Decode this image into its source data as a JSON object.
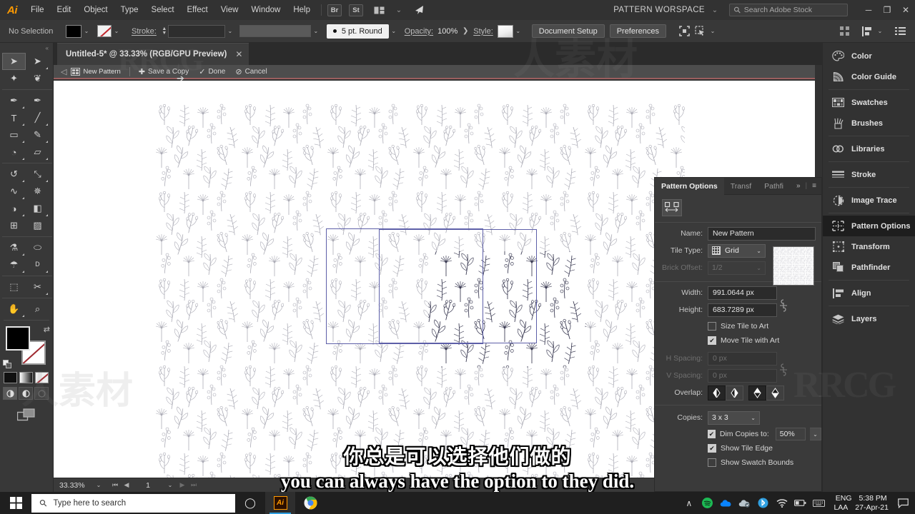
{
  "app": {
    "name": "Adobe Illustrator",
    "logo_text": "Ai",
    "accent_color": "#ff9a00"
  },
  "menubar": {
    "items": [
      "File",
      "Edit",
      "Object",
      "Type",
      "Select",
      "Effect",
      "View",
      "Window",
      "Help"
    ],
    "quick_icons": [
      {
        "name": "bridge-icon",
        "label": "Br"
      },
      {
        "name": "stock-icon",
        "label": "St"
      },
      {
        "name": "arrange-documents-icon",
        "label": "▤"
      },
      {
        "name": "chevron-down-icon",
        "label": "⌄"
      },
      {
        "name": "home-icon",
        "label": "➤"
      }
    ],
    "workspace": "PATTERN WORSPACE",
    "workspace_caret": "⌄",
    "search_placeholder": "Search Adobe Stock",
    "search_icon": "⌕",
    "window_controls": {
      "minimize": "─",
      "maximize": "❐",
      "close": "✕"
    }
  },
  "controlbar": {
    "selection_state": "No Selection",
    "fill_color": "#000000",
    "stroke_label": "Stroke:",
    "stroke_weight": "",
    "stroke_profile": "",
    "brush_label": "5 pt. Round",
    "opacity_label": "Opacity:",
    "opacity_value": "100%",
    "opacity_arrow": "❯",
    "style_label": "Style:",
    "buttons": [
      "Document Setup",
      "Preferences"
    ],
    "right_icons": [
      {
        "name": "transform-each-icon",
        "glyph": "⛶"
      },
      {
        "name": "select-similar-icon",
        "glyph": "⬚"
      },
      {
        "name": "arrange-grid-icon",
        "glyph": "∷"
      },
      {
        "name": "align-icon",
        "glyph": "⫶"
      },
      {
        "name": "properties-list-icon",
        "glyph": "☰"
      }
    ],
    "caret": "⌄"
  },
  "document_tab": {
    "title": "Untitled-5* @ 33.33% (RGB/GPU Preview)",
    "close": "✕"
  },
  "pattern_edit_bar": {
    "back_arrow": "◁",
    "swatch_name": "New Pattern",
    "actions": [
      {
        "name": "save-a-copy",
        "glyph": "✚",
        "label": "Save a Copy"
      },
      {
        "name": "done",
        "glyph": "✓",
        "label": "Done"
      },
      {
        "name": "cancel",
        "glyph": "⊘",
        "label": "Cancel"
      }
    ]
  },
  "pattern_options": {
    "tabs": [
      {
        "label": "Pattern Options",
        "active": true
      },
      {
        "label": "Transf",
        "active": false
      },
      {
        "label": "Pathfi",
        "active": false
      }
    ],
    "more_glyph": "»",
    "menu_glyph": "≡",
    "tile_tool_glyph": "⇔",
    "name_label": "Name:",
    "name_value": "New Pattern",
    "tile_type_label": "Tile Type:",
    "tile_type_value": "Grid",
    "brick_offset_label": "Brick Offset:",
    "brick_offset_value": "1/2",
    "width_label": "Width:",
    "width_value": "991.0644 px",
    "height_label": "Height:",
    "height_value": "683.7289 px",
    "link_glyph": "⚯",
    "size_tile_to_art": {
      "label": "Size Tile to Art",
      "checked": false
    },
    "move_tile_with_art": {
      "label": "Move Tile with Art",
      "checked": true
    },
    "h_spacing_label": "H Spacing:",
    "h_spacing_value": "0 px",
    "v_spacing_label": "V Spacing:",
    "v_spacing_value": "0 px",
    "overlap_label": "Overlap:",
    "overlap_options": [
      {
        "name": "overlap-left-in-front",
        "selected": true
      },
      {
        "name": "overlap-right-in-front",
        "selected": false
      },
      {
        "name": "overlap-bottom-in-front",
        "selected": true
      },
      {
        "name": "overlap-top-in-front",
        "selected": false
      }
    ],
    "copies_label": "Copies:",
    "copies_value": "3 x 3",
    "dim_copies": {
      "label": "Dim Copies to:",
      "checked": true,
      "value": "50%"
    },
    "show_tile_edge": {
      "label": "Show Tile Edge",
      "checked": true
    },
    "show_swatch_bounds": {
      "label": "Show Swatch Bounds",
      "checked": false
    },
    "caret": "⌄",
    "check_glyph": "✔"
  },
  "dock": {
    "groups": [
      [
        {
          "label": "Color",
          "icon": "color-palette-icon",
          "active": false
        },
        {
          "label": "Color Guide",
          "icon": "color-guide-icon",
          "active": false
        }
      ],
      [
        {
          "label": "Swatches",
          "icon": "swatches-icon",
          "active": false
        },
        {
          "label": "Brushes",
          "icon": "brushes-icon",
          "active": false
        }
      ],
      [
        {
          "label": "Libraries",
          "icon": "libraries-icon",
          "active": false
        }
      ],
      [
        {
          "label": "Stroke",
          "icon": "stroke-icon",
          "active": false
        }
      ],
      [
        {
          "label": "Image Trace",
          "icon": "image-trace-icon",
          "active": false
        }
      ],
      [
        {
          "label": "Pattern Options",
          "icon": "pattern-options-icon",
          "active": true
        },
        {
          "label": "Transform",
          "icon": "transform-icon",
          "active": false
        },
        {
          "label": "Pathfinder",
          "icon": "pathfinder-icon",
          "active": false
        }
      ],
      [
        {
          "label": "Align",
          "icon": "align-icon",
          "active": false
        }
      ],
      [
        {
          "label": "Layers",
          "icon": "layers-icon",
          "active": false
        }
      ]
    ]
  },
  "toolbar": {
    "tools": [
      {
        "name": "selection-tool",
        "glyph": "➤",
        "selected": true,
        "flyout": false
      },
      {
        "name": "direct-selection-tool",
        "glyph": "➤",
        "selected": false,
        "flyout": true
      },
      {
        "name": "magic-wand-tool",
        "glyph": "✦",
        "selected": false,
        "flyout": false
      },
      {
        "name": "lasso-tool",
        "glyph": "❦",
        "selected": false,
        "flyout": false
      },
      {
        "name": "pen-tool",
        "glyph": "✒",
        "selected": false,
        "flyout": true
      },
      {
        "name": "curvature-tool",
        "glyph": "✒",
        "selected": false,
        "flyout": false
      },
      {
        "name": "type-tool",
        "glyph": "T",
        "selected": false,
        "flyout": true
      },
      {
        "name": "line-segment-tool",
        "glyph": "╱",
        "selected": false,
        "flyout": true
      },
      {
        "name": "rectangle-tool",
        "glyph": "▭",
        "selected": false,
        "flyout": true
      },
      {
        "name": "paintbrush-tool",
        "glyph": "✎",
        "selected": false,
        "flyout": true
      },
      {
        "name": "shaper-tool",
        "glyph": "◔",
        "selected": false,
        "flyout": true
      },
      {
        "name": "eraser-tool",
        "glyph": "▱",
        "selected": false,
        "flyout": true
      },
      {
        "name": "rotate-tool",
        "glyph": "↺",
        "selected": false,
        "flyout": true
      },
      {
        "name": "scale-tool",
        "glyph": "⤡",
        "selected": false,
        "flyout": true
      },
      {
        "name": "width-tool",
        "glyph": "∿",
        "selected": false,
        "flyout": true
      },
      {
        "name": "free-transform-tool",
        "glyph": "✵",
        "selected": false,
        "flyout": false
      },
      {
        "name": "shape-builder-tool",
        "glyph": "◑",
        "selected": false,
        "flyout": true
      },
      {
        "name": "perspective-grid-tool",
        "glyph": "◧",
        "selected": false,
        "flyout": true
      },
      {
        "name": "mesh-tool",
        "glyph": "⊞",
        "selected": false,
        "flyout": false
      },
      {
        "name": "gradient-tool",
        "glyph": "▨",
        "selected": false,
        "flyout": false
      },
      {
        "name": "eyedropper-tool",
        "glyph": "⚗",
        "selected": false,
        "flyout": true
      },
      {
        "name": "blend-tool",
        "glyph": "⬭",
        "selected": false,
        "flyout": false
      },
      {
        "name": "symbol-sprayer-tool",
        "glyph": "☂",
        "selected": false,
        "flyout": true
      },
      {
        "name": "column-graph-tool",
        "glyph": "ᴰ",
        "selected": false,
        "flyout": true
      },
      {
        "name": "artboard-tool",
        "glyph": "⬚",
        "selected": false,
        "flyout": false
      },
      {
        "name": "slice-tool",
        "glyph": "✂",
        "selected": false,
        "flyout": true
      },
      {
        "name": "hand-tool",
        "glyph": "✋",
        "selected": false,
        "flyout": true
      },
      {
        "name": "zoom-tool",
        "glyph": "⌕",
        "selected": false,
        "flyout": false
      }
    ],
    "fill_color": "#000000",
    "stroke_color": "#ffffff",
    "swap_glyph": "⇄",
    "mini_swatches": [
      {
        "name": "color-swatch",
        "type": "black"
      },
      {
        "name": "gradient-swatch",
        "type": "grad"
      },
      {
        "name": "none-swatch",
        "type": "none"
      }
    ],
    "draw_modes": [
      {
        "name": "draw-normal-mode",
        "glyph": "◔",
        "selected": true
      },
      {
        "name": "draw-behind-mode",
        "glyph": "◑",
        "selected": false
      },
      {
        "name": "draw-inside-mode",
        "glyph": "○",
        "selected": false,
        "dim": true
      }
    ],
    "screen_mode_glyph": "❐"
  },
  "statusbar": {
    "zoom": "33.33%",
    "page": "1",
    "caret": "⌄",
    "nav": [
      "⏮",
      "◀",
      "▶",
      "⏭"
    ]
  },
  "subtitles": {
    "chinese": "你总是可以选择他们做的",
    "english": "you can always have the option to they did."
  },
  "taskbar": {
    "start_glyph": "⊞",
    "search_placeholder": "Type here to search",
    "search_icon": "⌕",
    "cortana_glyph": "◯",
    "apps": [
      {
        "name": "illustrator-taskbar-button",
        "label": "Ai",
        "active": true
      },
      {
        "name": "chrome-taskbar-button",
        "label": "",
        "active": false
      }
    ],
    "tray": [
      {
        "name": "show-hidden-icons",
        "glyph": "∧"
      },
      {
        "name": "spotify-tray-icon",
        "glyph": "●",
        "color": "#1db954"
      },
      {
        "name": "onedrive-tray-icon",
        "glyph": "☁",
        "color": "#0a84ff"
      },
      {
        "name": "cloud-sync-tray-icon",
        "glyph": "☁",
        "color": "#b9c5cc"
      },
      {
        "name": "bluetooth-tray-icon",
        "glyph": "ᛗ",
        "color": "#2f9fe0"
      },
      {
        "name": "wifi-tray-icon",
        "glyph": "◠",
        "color": "#d8d8d8"
      },
      {
        "name": "battery-tray-icon",
        "glyph": "▭",
        "color": "#d8d8d8"
      },
      {
        "name": "keyboard-tray-icon",
        "glyph": "⌨",
        "color": "#d8d8d8"
      }
    ],
    "language": "ENG",
    "locale": "LAA",
    "time": "5:38 PM",
    "date": "27-Apr-21",
    "action_center_glyph": "❐"
  },
  "canvas": {
    "tile_outline_color": "#5d5fa8",
    "background": "#ffffff",
    "dim_opacity": "50%"
  },
  "watermarks": [
    "RRCG",
    "人人素材"
  ]
}
